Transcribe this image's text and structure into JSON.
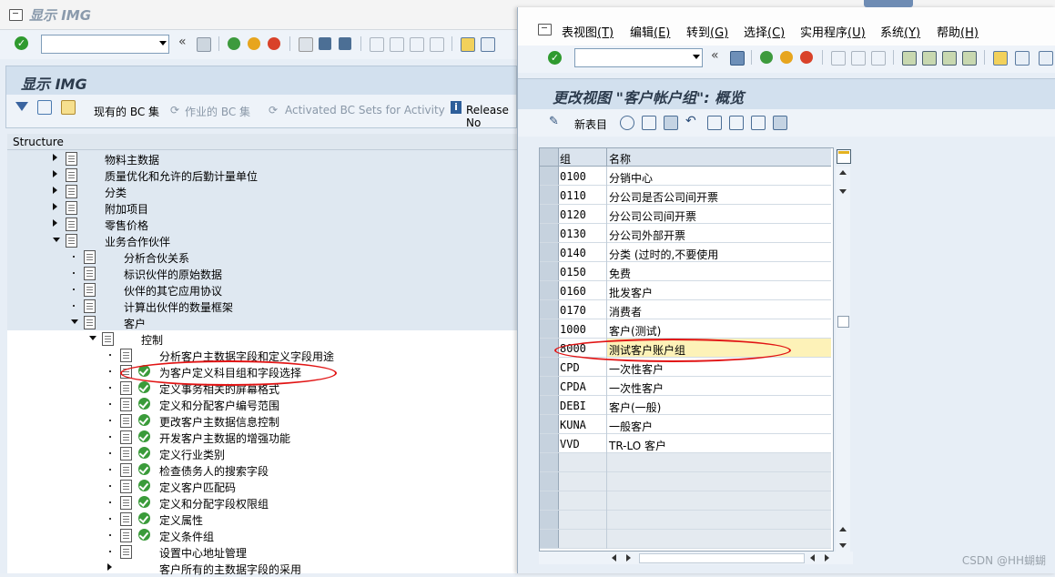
{
  "back_window": {
    "title": "显示 IMG",
    "header_title": "显示 IMG",
    "app_toolbar": {
      "bc_sets": "现有的 BC 集",
      "bc_sets_activity": "作业的 BC 集",
      "activated_bc": "Activated BC Sets for Activity",
      "release_notes": "Release No"
    },
    "structure_label": "Structure",
    "tree": [
      {
        "label": "物料主数据",
        "expand": "r",
        "level": 0,
        "icon": "doc",
        "hl": true
      },
      {
        "label": "质量优化和允许的后勤计量单位",
        "expand": "r",
        "level": 0,
        "icon": "doc",
        "hl": true
      },
      {
        "label": "分类",
        "expand": "r",
        "level": 0,
        "icon": "doc",
        "hl": true
      },
      {
        "label": "附加项目",
        "expand": "r",
        "level": 0,
        "icon": "doc",
        "hl": true
      },
      {
        "label": "零售价格",
        "expand": "r",
        "level": 0,
        "icon": "doc",
        "hl": true
      },
      {
        "label": "业务合作伙伴",
        "expand": "d",
        "level": 0,
        "icon": "doc",
        "hl": true
      },
      {
        "label": "分析合伙关系",
        "expand": "dot",
        "level": 1,
        "icon": "doc",
        "hl": true
      },
      {
        "label": "标识伙伴的原始数据",
        "expand": "dot",
        "level": 1,
        "icon": "doc",
        "hl": true
      },
      {
        "label": "伙伴的其它应用协议",
        "expand": "dot",
        "level": 1,
        "icon": "doc",
        "hl": true
      },
      {
        "label": "计算出伙伴的数量框架",
        "expand": "dot",
        "level": 1,
        "icon": "doc",
        "hl": true
      },
      {
        "label": "客户",
        "expand": "d",
        "level": 1,
        "icon": "doc",
        "hl": true
      },
      {
        "label": "控制",
        "expand": "d",
        "level": 2,
        "icon": "doc",
        "hl": false
      },
      {
        "label": "分析客户主数据字段和定义字段用途",
        "expand": "dot",
        "level": 3,
        "icon": "doc",
        "hl": false
      },
      {
        "label": "为客户定义科目组和字段选择",
        "expand": "dot",
        "level": 3,
        "icon": "docchk",
        "hl": false
      },
      {
        "label": "定义事务相关的屏幕格式",
        "expand": "dot",
        "level": 3,
        "icon": "docchk",
        "hl": false
      },
      {
        "label": "定义和分配客户编号范围",
        "expand": "dot",
        "level": 3,
        "icon": "docchk",
        "hl": false
      },
      {
        "label": "更改客户主数据信息控制",
        "expand": "dot",
        "level": 3,
        "icon": "docchk",
        "hl": false
      },
      {
        "label": "开发客户主数据的增强功能",
        "expand": "dot",
        "level": 3,
        "icon": "docchk",
        "hl": false
      },
      {
        "label": "定义行业类别",
        "expand": "dot",
        "level": 3,
        "icon": "docchk",
        "hl": false
      },
      {
        "label": "检查债务人的搜索字段",
        "expand": "dot",
        "level": 3,
        "icon": "docchk",
        "hl": false
      },
      {
        "label": "定义客户匹配码",
        "expand": "dot",
        "level": 3,
        "icon": "docchk",
        "hl": false
      },
      {
        "label": "定义和分配字段权限组",
        "expand": "dot",
        "level": 3,
        "icon": "docchk",
        "hl": false
      },
      {
        "label": "定义属性",
        "expand": "dot",
        "level": 3,
        "icon": "docchk",
        "hl": false
      },
      {
        "label": "定义条件组",
        "expand": "dot",
        "level": 3,
        "icon": "docchk",
        "hl": false
      },
      {
        "label": "设置中心地址管理",
        "expand": "dot",
        "level": 3,
        "icon": "doc",
        "hl": false
      },
      {
        "label": "客户所有的主数据字段的采用",
        "expand": "r",
        "level": 3,
        "icon": "none",
        "hl": false
      }
    ]
  },
  "front_window": {
    "menu": [
      {
        "label": "表视图",
        "key": "(T)"
      },
      {
        "label": "编辑",
        "key": "(E)"
      },
      {
        "label": "转到",
        "key": "(G)"
      },
      {
        "label": "选择",
        "key": "(C)"
      },
      {
        "label": "实用程序",
        "key": "(U)"
      },
      {
        "label": "系统",
        "key": "(Y)"
      },
      {
        "label": "帮助",
        "key": "(H)"
      }
    ],
    "header_title": "更改视图 \"客户帐户组\": 概览",
    "new_entries": "新表目",
    "table": {
      "col_group": "组",
      "col_name": "名称",
      "rows": [
        {
          "group": "0100",
          "name": "分销中心"
        },
        {
          "group": "0110",
          "name": "分公司是否公司间开票"
        },
        {
          "group": "0120",
          "name": "分公司公司间开票"
        },
        {
          "group": "0130",
          "name": "分公司外部开票"
        },
        {
          "group": "0140",
          "name": "分类 (过时的,不要使用"
        },
        {
          "group": "0150",
          "name": "免费"
        },
        {
          "group": "0160",
          "name": "批发客户"
        },
        {
          "group": "0170",
          "name": "消费者"
        },
        {
          "group": "1000",
          "name": "客户(测试)"
        },
        {
          "group": "8000",
          "name": "测试客户账户组"
        },
        {
          "group": "CPD",
          "name": "一次性客户"
        },
        {
          "group": "CPDA",
          "name": "一次性客户"
        },
        {
          "group": "DEBI",
          "name": "客户(一般)"
        },
        {
          "group": "KUNA",
          "name": "一般客户"
        },
        {
          "group": "VVD",
          "name": "TR-LO 客户"
        }
      ]
    }
  },
  "watermark": "CSDN @HH蝴蝴",
  "colors": {
    "annotation": "#e11414",
    "selection": "#fdf2b8"
  }
}
